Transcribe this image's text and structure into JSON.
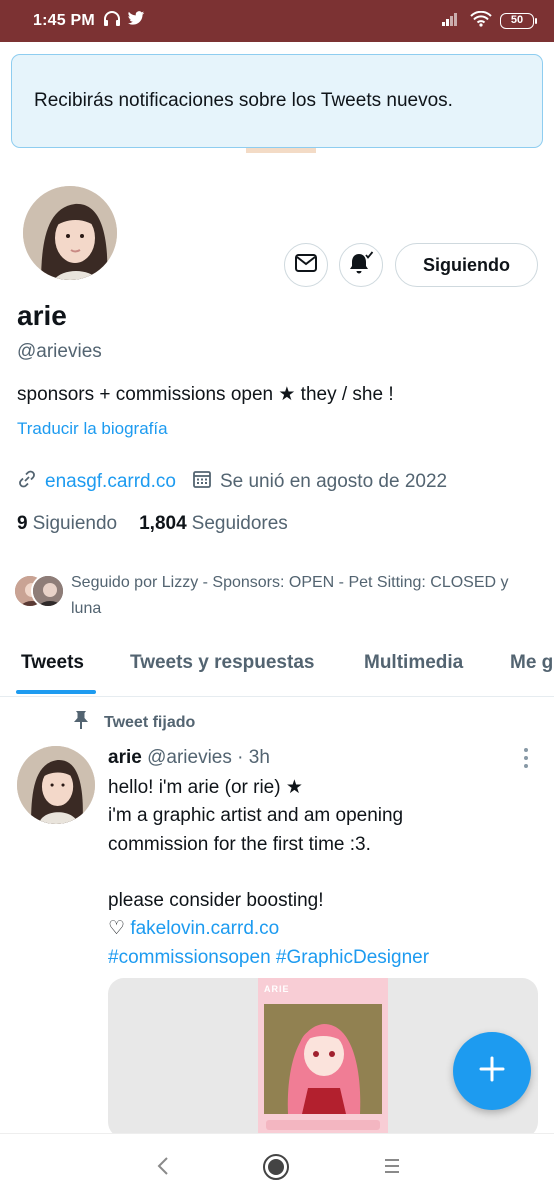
{
  "status_bar": {
    "time": "1:45 PM",
    "battery": "50"
  },
  "toast": {
    "message": "Recibirás notificaciones sobre los Tweets nuevos."
  },
  "profile": {
    "name": "arie",
    "handle": "@arievies",
    "bio": "sponsors + commissions open ★ they / she !",
    "translate_label": "Traducir la biografía",
    "link": "enasgf.carrd.co",
    "joined": "Se unió en agosto de 2022",
    "following_count": "9",
    "following_label": "Siguiendo",
    "followers_count": "1,804",
    "followers_label": "Seguidores",
    "followed_by": "Seguido por Lizzy - Sponsors: OPEN - Pet Sitting: CLOSED y luna",
    "follow_button": "Siguiendo"
  },
  "tabs": [
    {
      "label": "Tweets",
      "active": true
    },
    {
      "label": "Tweets y respuestas",
      "active": false
    },
    {
      "label": "Multimedia",
      "active": false
    },
    {
      "label": "Me g",
      "active": false
    }
  ],
  "pinned_tweet": {
    "pinned_label": "Tweet fijado",
    "author_name": "arie",
    "author_handle": "@arievies",
    "time": "· 3h",
    "lines": [
      "hello! i'm arie (or rie) ★",
      "i'm a graphic artist and am opening",
      "commission for the first time :3."
    ],
    "line4": "please consider boosting!",
    "heart_prefix": "♡",
    "link": "fakelovin.carrd.co",
    "hashtags": "#commissionsopen #GraphicDesigner",
    "media_header": "ARIE"
  },
  "colors": {
    "accent": "#1d9bf0",
    "status_bar": "#7c3233",
    "toast_bg": "#e6f4fb"
  }
}
